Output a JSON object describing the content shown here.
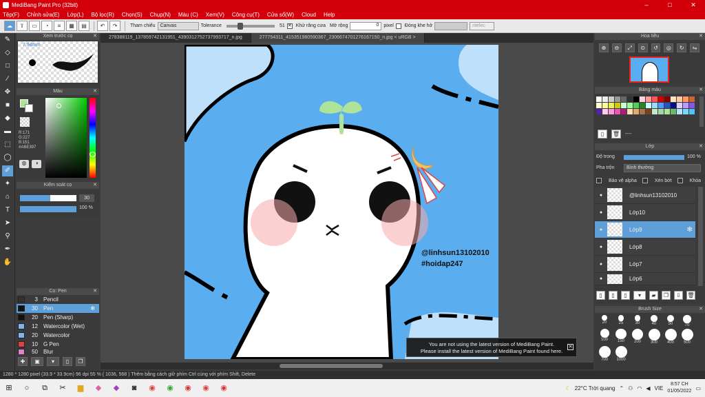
{
  "window": {
    "title": "MediBang Paint Pro (32bit)",
    "min": "–",
    "max": "□",
    "close": "✕"
  },
  "menu": [
    "Tệp(F)",
    "Chỉnh sửa(E)",
    "Lớp(L)",
    "Bộ lọc(R)",
    "Chọn(S)",
    "Chụp(N)",
    "Màu (C)",
    "Xem(V)",
    "Công cụ(T)",
    "Cửa sổ(W)",
    "Cloud",
    "Help"
  ],
  "toolbar": {
    "ref_label": "Tham chiếu",
    "ref_value": "Canvas",
    "tolerance_label": "Tolerance",
    "tolerance_value": "51",
    "antialias_label": "Khử răng cưa",
    "expand_label": "Mở rộng",
    "expand_value": "0",
    "unit": "pixel",
    "gap_label": "Đóng khe hở",
    "gap_value": "ntelec"
  },
  "tabs": [
    "278388119_137859742131951_4390312752737993717_n.jpg",
    "277754311_415351980590367_2306674701276167150_n.jpg < uRGB >"
  ],
  "preview": {
    "title": "Xem trước cọ",
    "size": "7.94mm"
  },
  "color": {
    "title": "Màu",
    "r": "R:171",
    "g": "G:227",
    "b": "B:151",
    "hex": "#ABE397",
    "fg": "#abe397"
  },
  "brush_control": {
    "title": "Kiểm soát cọ",
    "size": "30",
    "opacity": "100 %"
  },
  "brush": {
    "title": "Cọ: Pen",
    "items": [
      {
        "n": "3",
        "name": "Pencil",
        "color": "#333333"
      },
      {
        "n": "30",
        "name": "Pen",
        "color": "#111111"
      },
      {
        "n": "20",
        "name": "Pen (Sharp)",
        "color": "#111111"
      },
      {
        "n": "12",
        "name": "Watercolor (Wet)",
        "color": "#7fb4e8"
      },
      {
        "n": "20",
        "name": "Watercolor",
        "color": "#7fb4e8"
      },
      {
        "n": "10",
        "name": "G Pen",
        "color": "#e04040"
      },
      {
        "n": "50",
        "name": "Blur",
        "color": "#e080d0"
      }
    ]
  },
  "canvas_text": {
    "handle": "@linhsun13102010",
    "tag": "#hoidap247"
  },
  "notice": {
    "line1": "You are not using the latest version of MediBang Paint.",
    "line2": "Please install the latest version of MediBang Paint found here."
  },
  "navigator": {
    "title": "Hoa tiêu"
  },
  "palette": {
    "title": "Bảng màu",
    "dash": "----"
  },
  "layers": {
    "title": "Lớp",
    "opacity_label": "Độ trong",
    "opacity_value": "100 %",
    "blend_label": "Pha trộn",
    "blend_value": "Bình thường",
    "protect_alpha": "Bảo vệ alpha",
    "clip": "Xén bớt",
    "lock": "Khóa",
    "items": [
      "@linhsun13102010",
      "Lớp10",
      "Lớp9",
      "Lớp8",
      "Lớp7",
      "Lớp6"
    ]
  },
  "brush_size": {
    "title": "Brush Size",
    "sizes": [
      "20",
      "25",
      "30",
      "40",
      "50",
      "70",
      "100",
      "150",
      "200",
      "300",
      "400",
      "500",
      "700",
      "1000"
    ]
  },
  "status": {
    "text": "1280 * 1280 pixel   (33.9 * 33.9cm)   96 dpi   55 %   ( 1036, 568 )   Thêm bằng cách giữ phím Ctrl cùng với phím Shift, Delete"
  },
  "taskbar": {
    "weather": "22°C  Trời quang",
    "lang": "VIE",
    "time": "8:57 CH",
    "date": "01/05/2022"
  },
  "palette_colors": [
    "#ffffff",
    "#eeeeee",
    "#cccccc",
    "#999999",
    "#666666",
    "#333333",
    "#000000",
    "#ffd1dc",
    "#ff9999",
    "#ff5555",
    "#cc0000",
    "#880000",
    "#ffe4c4",
    "#ffcc99",
    "#ff9966",
    "#cc6633",
    "#ffffcc",
    "#ffff99",
    "#eeee55",
    "#cccc00",
    "#ccffcc",
    "#99ff99",
    "#55cc55",
    "#228822",
    "#ccffff",
    "#99ddff",
    "#5599ff",
    "#2255cc",
    "#001188",
    "#e0ccff",
    "#bb99ff",
    "#8855ee",
    "#5522aa",
    "#ffccee",
    "#ff99dd",
    "#ee55bb",
    "#aa2277",
    "#ffe0b0",
    "#ddaa77",
    "#aa7744",
    "#774422",
    "#c8e6c9",
    "#a5d6a7",
    "#abe397",
    "#66bb6a",
    "#b3e5fc",
    "#81d4fa",
    "#4fc3f7"
  ]
}
